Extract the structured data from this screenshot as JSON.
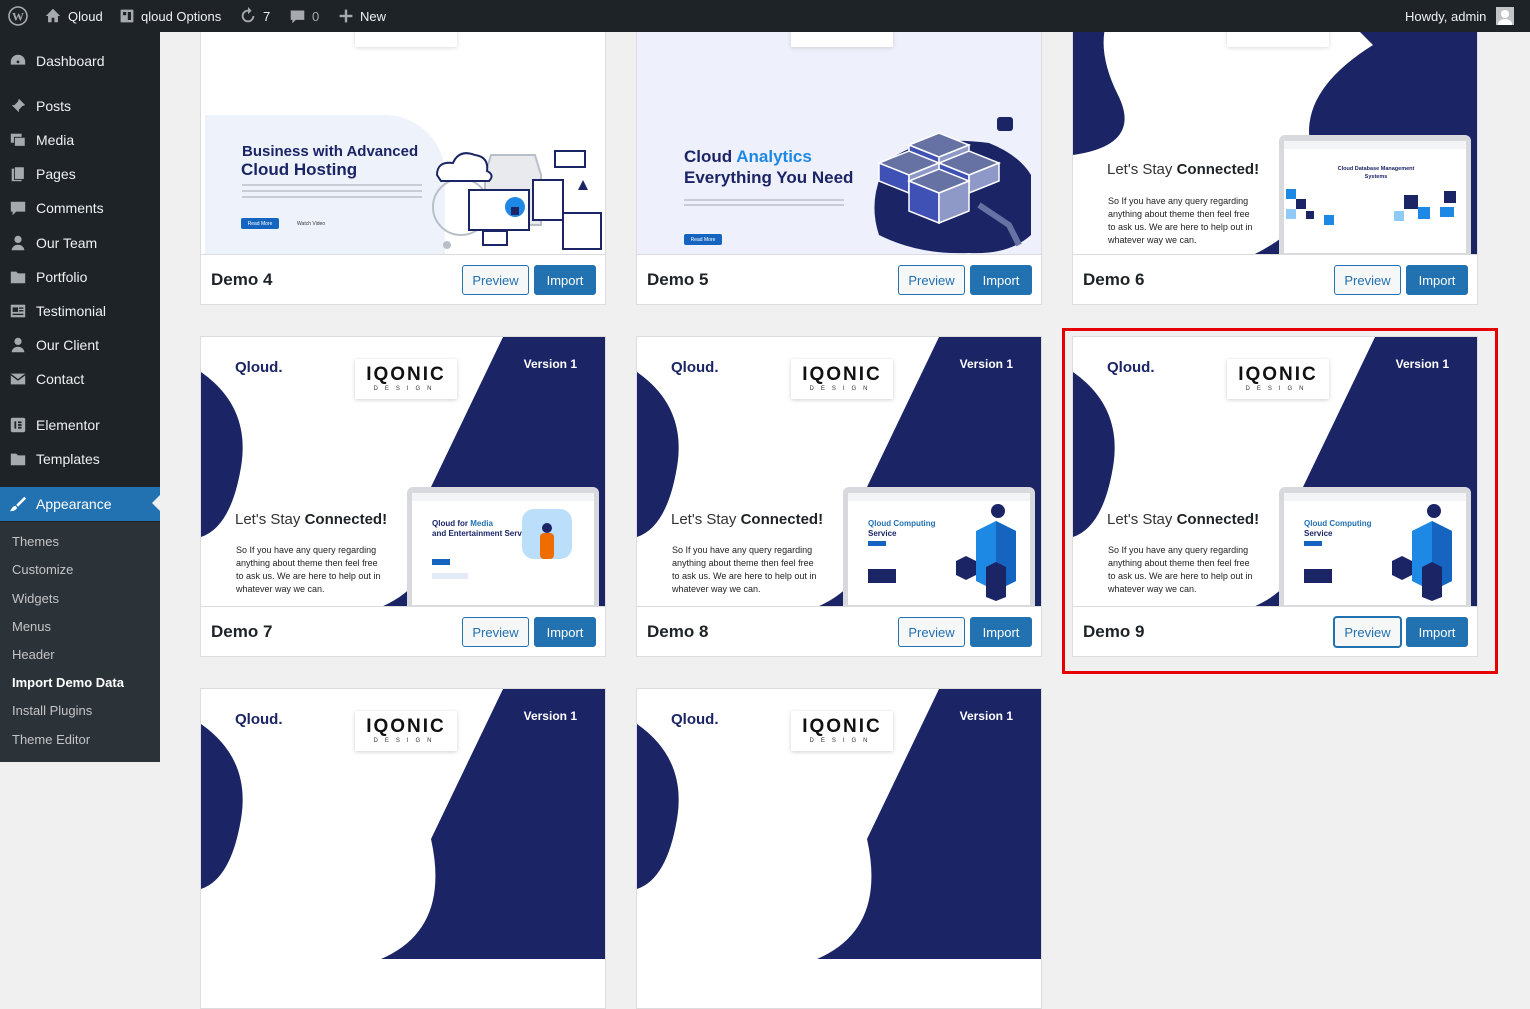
{
  "adminbar": {
    "site_name": "Qloud",
    "options": "qloud Options",
    "updates_count": "7",
    "comments_count": "0",
    "new_label": "New",
    "greeting": "Howdy, admin"
  },
  "sidebar": {
    "items": [
      {
        "label": "Dashboard",
        "icon": "dashboard-icon"
      },
      {
        "label": "Posts",
        "icon": "pin-icon"
      },
      {
        "label": "Media",
        "icon": "media-icon"
      },
      {
        "label": "Pages",
        "icon": "pages-icon"
      },
      {
        "label": "Comments",
        "icon": "comment-icon"
      },
      {
        "label": "Our Team",
        "icon": "user-icon"
      },
      {
        "label": "Portfolio",
        "icon": "folder-icon"
      },
      {
        "label": "Testimonial",
        "icon": "testimonial-icon"
      },
      {
        "label": "Our Client",
        "icon": "user-icon"
      },
      {
        "label": "Contact",
        "icon": "envelope-icon"
      },
      {
        "label": "Elementor",
        "icon": "elementor-icon"
      },
      {
        "label": "Templates",
        "icon": "folder-icon"
      },
      {
        "label": "Appearance",
        "icon": "brush-icon"
      }
    ],
    "submenu": [
      "Themes",
      "Customize",
      "Widgets",
      "Menus",
      "Header",
      "Import Demo Data",
      "Install Plugins",
      "Theme Editor"
    ],
    "current_submenu": "Import Demo Data"
  },
  "buttons": {
    "preview": "Preview",
    "import": "Import"
  },
  "demos": [
    {
      "name": "Demo 4",
      "title_line1": "Business with Advanced",
      "title_line2": "Cloud Hosting",
      "cta": "Read More",
      "cta2": "Watch Video"
    },
    {
      "name": "Demo 5",
      "title_part1": "Cloud ",
      "title_accent": "Analytics",
      "title_line2": "Everything You Need",
      "cta": "Read More"
    },
    {
      "name": "Demo 6",
      "heading_light": "Let's Stay ",
      "heading_bold": "Connected!",
      "body": "So If you have any query regarding anything about theme then feel free to ask us. We are here to help out in whatever way we can.",
      "screen_title": "Cloud Database Management Systems"
    },
    {
      "name": "Demo 7",
      "screen_title_part1": "Qloud for ",
      "screen_title_accent": "Media",
      "screen_title_part2": "and Entertainment Service"
    },
    {
      "name": "Demo 8",
      "screen_title_part1": "Qloud Computing",
      "screen_title_part2": "Service"
    },
    {
      "name": "Demo 9",
      "screen_title_part1": "Qloud Computing",
      "screen_title_part2": "Service"
    }
  ],
  "contact_thumb": {
    "logo": "Qloud.",
    "brand_top": "IQONIC",
    "brand_bottom": "DESIGN",
    "version": "Version 1",
    "heading_light": "Let's Stay ",
    "heading_bold": "Connected!",
    "body": "So If you have any query regarding anything about theme then feel free to ask us. We are here to help out in whatever way we can."
  },
  "colors": {
    "navy": "#1b2566",
    "wp_blue": "#2271b1",
    "highlight": "#e60000"
  }
}
